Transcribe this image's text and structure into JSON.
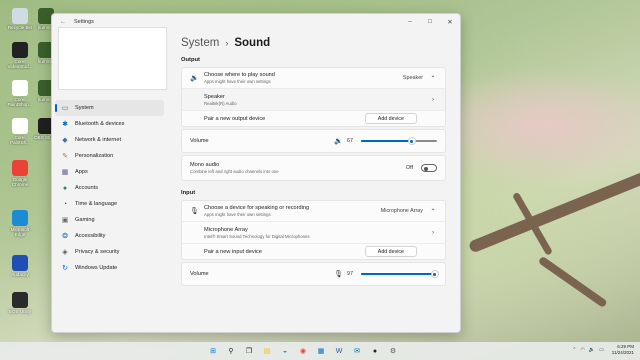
{
  "desktop": {
    "icons": [
      {
        "label": "Recycle Bin",
        "icon": "recycle-bin-icon",
        "color": "#d0dbe4"
      },
      {
        "label": "hummm",
        "icon": "app-icon",
        "color": "#3a5f2c"
      },
      {
        "label": "Corel VideoStud...",
        "icon": "corel-videostudio-icon",
        "color": "#222222"
      },
      {
        "label": "hummm",
        "icon": "app-icon",
        "color": "#3a5f2c"
      },
      {
        "label": "Corel PaintShop...",
        "icon": "corel-paintshop-icon",
        "color": "#ffffff"
      },
      {
        "label": "hummm",
        "icon": "app-icon",
        "color": "#3a5f2c"
      },
      {
        "label": "Corel PaintSh...",
        "icon": "corel-paintshop-icon",
        "color": "#ffffff"
      },
      {
        "label": "OBS Studio",
        "icon": "obs-icon",
        "color": "#202020"
      },
      {
        "label": "Google Chrome",
        "icon": "chrome-icon",
        "color": "#ea4335"
      },
      {
        "label": "Microsoft Edge",
        "icon": "edge-icon",
        "color": "#1c8bd6"
      },
      {
        "label": "Audacity",
        "icon": "audacity-icon",
        "color": "#1f4fb5"
      },
      {
        "label": "EOS Utility",
        "icon": "eos-utility-icon",
        "color": "#2a2a2a"
      }
    ]
  },
  "window": {
    "title": "Settings",
    "back_glyph": "←",
    "minimize": "–",
    "maximize": "□",
    "close": "✕"
  },
  "sidebar": {
    "items": [
      {
        "label": "System",
        "icon": "monitor-icon",
        "glyph": "▭",
        "color": "#2b6cb0",
        "active": true
      },
      {
        "label": "Bluetooth & devices",
        "icon": "bluetooth-icon",
        "glyph": "✱",
        "color": "#0067c0"
      },
      {
        "label": "Network & internet",
        "icon": "network-icon",
        "glyph": "◆",
        "color": "#4a6fa5"
      },
      {
        "label": "Personalization",
        "icon": "brush-icon",
        "glyph": "✎",
        "color": "#c76b20"
      },
      {
        "label": "Apps",
        "icon": "apps-icon",
        "glyph": "▦",
        "color": "#5b5b8a"
      },
      {
        "label": "Accounts",
        "icon": "account-icon",
        "glyph": "●",
        "color": "#1e8a5a"
      },
      {
        "label": "Time & language",
        "icon": "globe-clock-icon",
        "glyph": "◔",
        "color": "#0067c0"
      },
      {
        "label": "Gaming",
        "icon": "controller-icon",
        "glyph": "▣",
        "color": "#666666"
      },
      {
        "label": "Accessibility",
        "icon": "accessibility-icon",
        "glyph": "❂",
        "color": "#2d6fb5"
      },
      {
        "label": "Privacy & security",
        "icon": "shield-icon",
        "glyph": "◈",
        "color": "#555555"
      },
      {
        "label": "Windows Update",
        "icon": "update-icon",
        "glyph": "↻",
        "color": "#0067c0"
      }
    ]
  },
  "breadcrumb": {
    "parent": "System",
    "separator": "›",
    "current": "Sound"
  },
  "output": {
    "section_label": "Output",
    "choose_title": "Choose where to play sound",
    "choose_sub": "Apps might have their own settings",
    "choose_value": "Speaker",
    "device_name": "Speaker",
    "device_sub": "Realtek(R) Audio",
    "pair_label": "Pair a new output device",
    "pair_button": "Add device",
    "volume_label": "Volume",
    "volume_value": "67",
    "volume_fraction": 0.67,
    "mono_title": "Mono audio",
    "mono_sub": "Combine left and right audio channels into one",
    "mono_state": "Off"
  },
  "input": {
    "section_label": "Input",
    "choose_title": "Choose a device for speaking or recording",
    "choose_sub": "Apps might have their own settings",
    "choose_value": "Microphone Array",
    "device_name": "Microphone Array",
    "device_sub": "Intel® Smart Sound Technology for Digital Microphones",
    "pair_label": "Pair a new input device",
    "pair_button": "Add device",
    "volume_label": "Volume",
    "volume_value": "97",
    "volume_fraction": 0.97
  },
  "glyphs": {
    "chev_up": "⌃",
    "chev_right": "›",
    "speaker": "🔉",
    "mic": "🎙",
    "monitor": "▭"
  },
  "taskbar": {
    "apps": [
      {
        "icon": "windows-start-icon",
        "glyph": "⊞",
        "color": "#0078d4"
      },
      {
        "icon": "search-icon",
        "glyph": "⚲",
        "color": "#222222"
      },
      {
        "icon": "task-view-icon",
        "glyph": "❐",
        "color": "#222222"
      },
      {
        "icon": "file-explorer-icon",
        "glyph": "▤",
        "color": "#f2c200"
      },
      {
        "icon": "edge-icon",
        "glyph": "◒",
        "color": "#1c8bd6"
      },
      {
        "icon": "chrome-icon",
        "glyph": "◉",
        "color": "#ea4335"
      },
      {
        "icon": "store-icon",
        "glyph": "▦",
        "color": "#0067c0"
      },
      {
        "icon": "word-icon",
        "glyph": "W",
        "color": "#2b579a"
      },
      {
        "icon": "mail-icon",
        "glyph": "✉",
        "color": "#0067c0"
      },
      {
        "icon": "obs-icon",
        "glyph": "●",
        "color": "#202020"
      },
      {
        "icon": "settings-gear-icon",
        "glyph": "⚙",
        "color": "#555555"
      }
    ],
    "tray": {
      "chevron": "⌃",
      "wifi": "◠",
      "volume": "🔉",
      "battery": "▭",
      "time": "6:29 PM",
      "date": "11/24/2021"
    }
  }
}
